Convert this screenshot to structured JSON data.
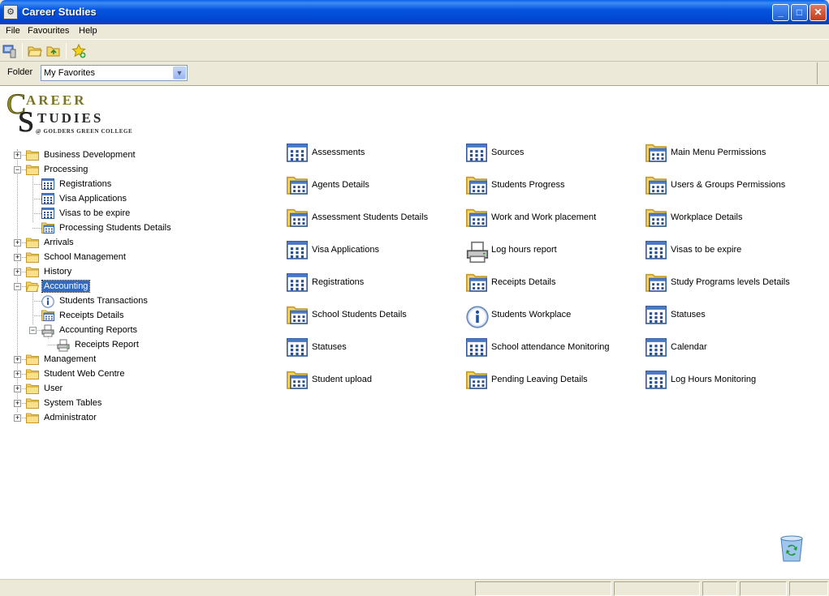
{
  "window": {
    "title": "Career Studies",
    "controls": {
      "minimize": "_",
      "maximize": "□",
      "close": "✕"
    }
  },
  "menu": [
    "File",
    "Favourites",
    "Help"
  ],
  "folder": {
    "label": "Folder",
    "value": "My Favorites"
  },
  "logo": {
    "line1": "AREER",
    "line2": "TUDIES",
    "tag": "@ GOLDERS GREEN COLLEGE"
  },
  "tree": [
    {
      "label": "Business Development",
      "expander": "+",
      "icon": "folder-icon"
    },
    {
      "label": "Processing",
      "expander": "−",
      "icon": "folder-icon"
    },
    {
      "label": "Registrations",
      "icon": "grid-form-icon"
    },
    {
      "label": "Visa Applications",
      "icon": "grid-form-icon"
    },
    {
      "label": "Visas to be expire",
      "icon": "grid-form-icon"
    },
    {
      "label": "Processing Students Details",
      "icon": "folder-form-icon"
    },
    {
      "label": "Arrivals",
      "expander": "+",
      "icon": "folder-icon"
    },
    {
      "label": "School Management",
      "expander": "+",
      "icon": "folder-icon"
    },
    {
      "label": "History",
      "expander": "+",
      "icon": "folder-icon"
    },
    {
      "label": "Accounting",
      "expander": "−",
      "icon": "open-folder-icon",
      "selected": true
    },
    {
      "label": "Students Transactions",
      "icon": "info-icon"
    },
    {
      "label": "Receipts Details",
      "icon": "folder-form-icon"
    },
    {
      "label": "Accounting Reports",
      "expander": "−",
      "icon": "printer-icon"
    },
    {
      "label": "Receipts Report",
      "icon": "printer-icon"
    },
    {
      "label": "Management",
      "expander": "+",
      "icon": "folder-icon"
    },
    {
      "label": "Student Web Centre",
      "expander": "+",
      "icon": "folder-icon"
    },
    {
      "label": "User",
      "expander": "+",
      "icon": "folder-icon"
    },
    {
      "label": "System Tables",
      "expander": "+",
      "icon": "folder-icon"
    },
    {
      "label": "Administrator",
      "expander": "+",
      "icon": "folder-icon"
    }
  ],
  "shortcuts": [
    [
      {
        "label": "Assessments",
        "icon": "grid-form-icon"
      },
      {
        "label": "Agents Details",
        "icon": "folder-form-icon"
      },
      {
        "label": "Assessment Students Details",
        "icon": "folder-form-icon"
      },
      {
        "label": "Visa Applications",
        "icon": "grid-form-icon"
      },
      {
        "label": "Registrations",
        "icon": "grid-form-icon"
      },
      {
        "label": "School Students Details",
        "icon": "folder-form-icon"
      },
      {
        "label": "Statuses",
        "icon": "grid-form-icon"
      },
      {
        "label": "Student upload",
        "icon": "folder-form-icon"
      }
    ],
    [
      {
        "label": "Sources",
        "icon": "grid-form-icon"
      },
      {
        "label": "Students Progress",
        "icon": "folder-form-icon"
      },
      {
        "label": "Work and Work placement",
        "icon": "folder-form-icon"
      },
      {
        "label": "Log hours report",
        "icon": "printer-icon"
      },
      {
        "label": "Receipts Details",
        "icon": "folder-form-icon"
      },
      {
        "label": "Students Workplace",
        "icon": "info-icon"
      },
      {
        "label": "School attendance Monitoring",
        "icon": "grid-form-icon"
      },
      {
        "label": "Pending Leaving Details",
        "icon": "folder-form-icon"
      }
    ],
    [
      {
        "label": "Main Menu Permissions",
        "icon": "folder-form-icon"
      },
      {
        "label": "Users & Groups Permissions",
        "icon": "folder-form-icon"
      },
      {
        "label": "Workplace Details",
        "icon": "folder-form-icon"
      },
      {
        "label": "Visas to be expire",
        "icon": "grid-form-icon"
      },
      {
        "label": "Study Programs levels Details",
        "icon": "folder-form-icon"
      },
      {
        "label": "Statuses",
        "icon": "grid-form-icon"
      },
      {
        "label": "Calendar",
        "icon": "grid-form-icon"
      },
      {
        "label": "Log Hours Monitoring",
        "icon": "grid-form-icon"
      }
    ]
  ]
}
